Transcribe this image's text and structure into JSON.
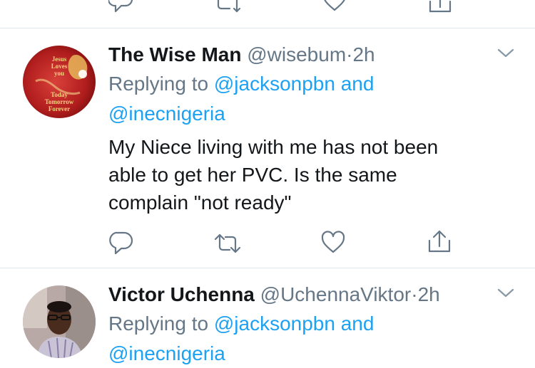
{
  "tweets": [
    {
      "name": "The Wise Man",
      "handle": "@wisebum",
      "sep": "·",
      "time": "2h",
      "reply_prefix": "Replying to",
      "reply_to_1": "@jacksonpbn",
      "reply_and": "and",
      "reply_to_2": "@inecnigeria",
      "body_lines": [
        "My Niece living with me has not been",
        "able to get her PVC. Is the same",
        "complain \"not ready\""
      ],
      "avatar_text": [
        "Jesus",
        "Loves",
        "you",
        "Today",
        "Tomorrow",
        "Forever"
      ]
    },
    {
      "name": "Victor Uchenna",
      "handle": "@UchennaViktor",
      "sep": "·",
      "time": "2h",
      "reply_prefix": "Replying to",
      "reply_to_1": "@jacksonpbn",
      "reply_and": "and",
      "reply_to_2": "@inecnigeria"
    }
  ],
  "icons": [
    "reply-icon",
    "retweet-icon",
    "like-icon",
    "share-icon",
    "chevron-down-icon"
  ],
  "colors": {
    "link": "#1da1f2",
    "muted": "#657786",
    "divider": "#e1e8ed",
    "text": "#14171a"
  }
}
